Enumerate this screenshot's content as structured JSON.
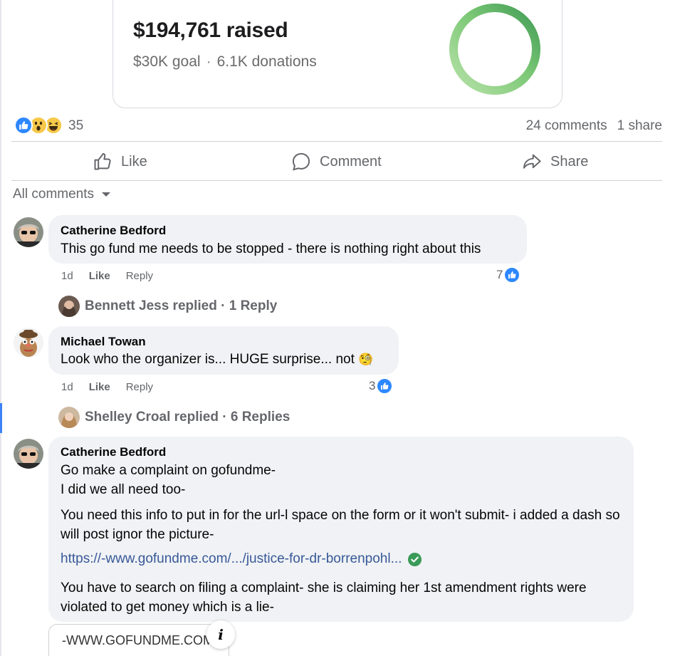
{
  "fundraiser": {
    "raised": "$194,761 raised",
    "goal": "$30K goal",
    "separator": "·",
    "donations": "6.1K donations",
    "progress_fraction": 1.0,
    "ring_color": "#4caf50"
  },
  "post_stats": {
    "reaction_icons": [
      "like-icon",
      "wow-icon",
      "haha-icon"
    ],
    "reaction_count": "35",
    "comments": "24 comments",
    "shares": "1 share"
  },
  "actions": {
    "like": "Like",
    "comment": "Comment",
    "share": "Share"
  },
  "comments_filter": "All comments",
  "comments": [
    {
      "author": "Catherine Bedford",
      "text": "This go fund me needs to be stopped - there is nothing right about this",
      "time": "1d",
      "like": "Like",
      "reply": "Reply",
      "like_count": "7",
      "replies": {
        "text": "Bennett Jess replied · 1 Reply"
      }
    },
    {
      "author": "Michael Towan",
      "text": "Look who the organizer is... HUGE surprise... not",
      "emoji": "🧐",
      "time": "1d",
      "like": "Like",
      "reply": "Reply",
      "like_count": "3",
      "replies": {
        "text": "Shelley Croal replied · 6 Replies"
      }
    },
    {
      "author": "Catherine Bedford",
      "lines": [
        "Go make a complaint on gofundme-",
        "I did we all need too-"
      ],
      "paragraph1": "You need this info to put in for the url-l space on the form or it won't submit- i added a dash so will post ignor the picture-",
      "link": "https://-www.gofundme.com/.../justice-for-dr-borrenpohl...",
      "paragraph2": "You have to search on filing a complaint- she is claiming her 1st amendment rights were violated to get money which is a lie-",
      "preview_site": "-WWW.GOFUNDME.COM"
    }
  ],
  "colors": {
    "facebook_blue": "#2d88ff",
    "link": "#385898",
    "bubble": "#f0f2f5",
    "secondary_text": "#65676b"
  }
}
